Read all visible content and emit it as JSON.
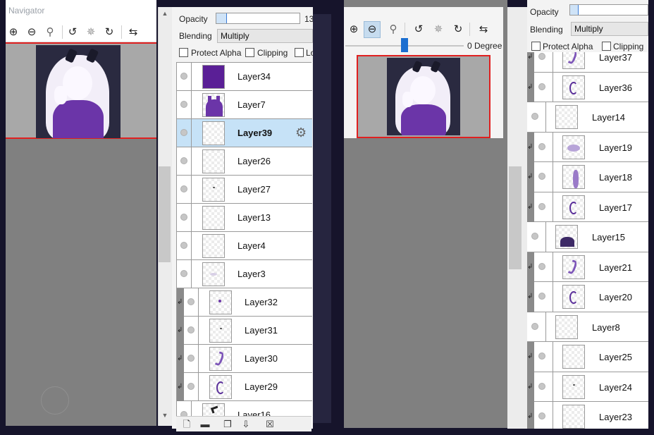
{
  "navigator": {
    "title": "Navigator",
    "toolbar_icons": [
      "zoom-in-icon",
      "zoom-out-icon",
      "zoom-reset-icon",
      "rotate-left-icon",
      "rotate-reset-icon",
      "rotate-right-icon",
      "flip-icon"
    ]
  },
  "layer_panel_left": {
    "opacity_label": "Opacity",
    "opacity_value": "13",
    "opacity_fraction": 0.13,
    "blending_label": "Blending",
    "blending_value": "Multiply",
    "protect_alpha_label": "Protect Alpha",
    "clipping_label": "Clipping",
    "lock_label": "Lo",
    "layers": [
      {
        "name": "Layer34",
        "thumb": "purple-fill",
        "clipped": false,
        "selected": false
      },
      {
        "name": "Layer7",
        "thumb": "purple-silhouette",
        "clipped": false,
        "selected": false
      },
      {
        "name": "Layer39",
        "thumb": "empty",
        "clipped": false,
        "selected": true
      },
      {
        "name": "Layer26",
        "thumb": "empty",
        "clipped": false,
        "selected": false
      },
      {
        "name": "Layer27",
        "thumb": "speck",
        "clipped": false,
        "selected": false
      },
      {
        "name": "Layer13",
        "thumb": "empty",
        "clipped": false,
        "selected": false
      },
      {
        "name": "Layer4",
        "thumb": "empty",
        "clipped": false,
        "selected": false
      },
      {
        "name": "Layer3",
        "thumb": "faint",
        "clipped": false,
        "selected": false
      },
      {
        "name": "Layer32",
        "thumb": "dot",
        "clipped": true,
        "selected": false
      },
      {
        "name": "Layer31",
        "thumb": "speck",
        "clipped": true,
        "selected": false
      },
      {
        "name": "Layer30",
        "thumb": "stroke",
        "clipped": true,
        "selected": false
      },
      {
        "name": "Layer29",
        "thumb": "curl",
        "clipped": true,
        "selected": false
      },
      {
        "name": "Layer16",
        "thumb": "dark-stroke",
        "clipped": false,
        "selected": false
      }
    ]
  },
  "right_navigator": {
    "rotation_label": "0 Degree",
    "rotation_fraction": 0.5
  },
  "layer_panel_right": {
    "opacity_label": "Opacity",
    "blending_label": "Blending",
    "blending_value": "Multiply",
    "protect_alpha_label": "Protect Alpha",
    "clipping_label": "Clipping",
    "layers": [
      {
        "name": "Layer37",
        "clipped": true,
        "thumb": "stroke"
      },
      {
        "name": "Layer36",
        "clipped": true,
        "thumb": "curl"
      },
      {
        "name": "Layer14",
        "clipped": false,
        "thumb": "empty"
      },
      {
        "name": "Layer19",
        "clipped": true,
        "thumb": "blob"
      },
      {
        "name": "Layer18",
        "clipped": true,
        "thumb": "tall-stroke"
      },
      {
        "name": "Layer17",
        "clipped": true,
        "thumb": "curl"
      },
      {
        "name": "Layer15",
        "clipped": false,
        "thumb": "silhouette"
      },
      {
        "name": "Layer21",
        "clipped": true,
        "thumb": "stroke"
      },
      {
        "name": "Layer20",
        "clipped": true,
        "thumb": "curl"
      },
      {
        "name": "Layer8",
        "clipped": false,
        "thumb": "empty"
      },
      {
        "name": "Layer25",
        "clipped": true,
        "thumb": "empty"
      },
      {
        "name": "Layer24",
        "clipped": true,
        "thumb": "speck"
      },
      {
        "name": "Layer23",
        "clipped": true,
        "thumb": "empty"
      }
    ]
  },
  "colors": {
    "selection": "#c6e2f7",
    "accent_blue": "#1c6fd0",
    "frame_red": "#e02020",
    "art_purple": "#6b35a8"
  }
}
